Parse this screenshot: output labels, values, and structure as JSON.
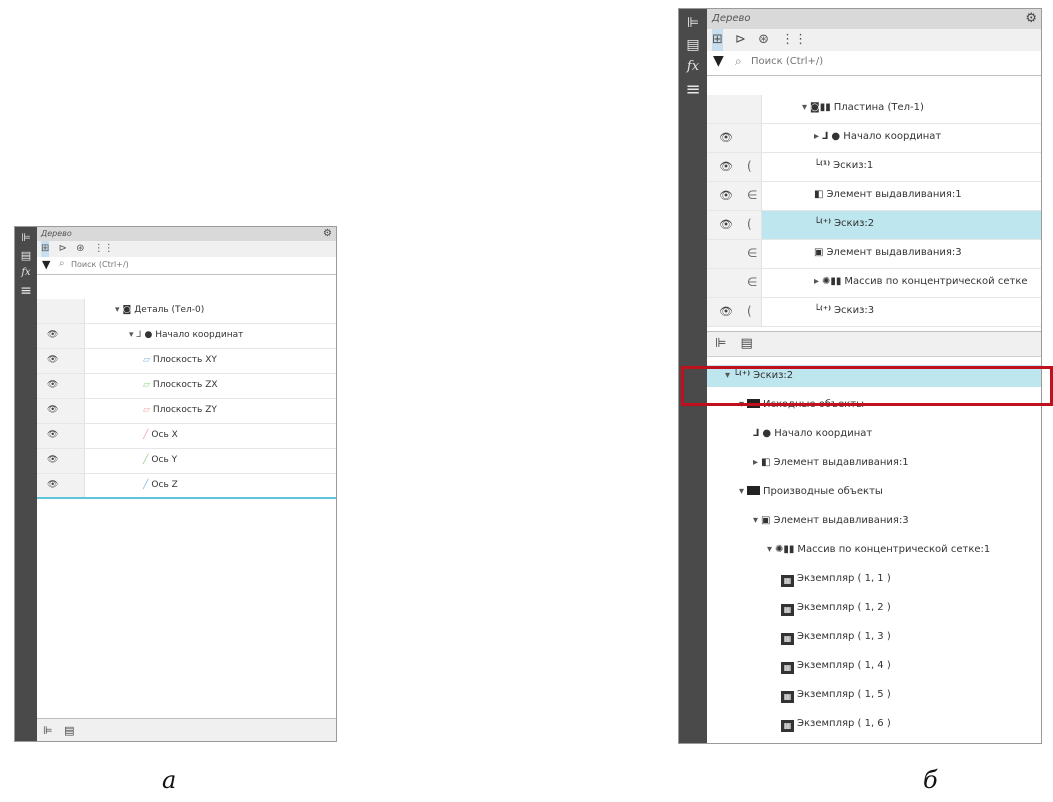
{
  "panel_a": {
    "title": "Дерево",
    "search_placeholder": "Поиск (Ctrl+/)",
    "rows": [
      {
        "label": "Деталь (Тел-0)",
        "indent": 0,
        "eye": false,
        "twisty": "▾",
        "icon": "◙",
        "icon_color": "#333333"
      },
      {
        "label": "● Начало координат",
        "indent": 1,
        "eye": true,
        "twisty": "▾",
        "icon": "⅃",
        "icon_color": "#555555"
      },
      {
        "label": "Плоскость XY",
        "indent": 2,
        "eye": true,
        "twisty": "",
        "icon": "▱",
        "icon_color": "#7ab3e8"
      },
      {
        "label": "Плоскость ZX",
        "indent": 2,
        "eye": true,
        "twisty": "",
        "icon": "▱",
        "icon_color": "#8fd07a"
      },
      {
        "label": "Плоскость ZY",
        "indent": 2,
        "eye": true,
        "twisty": "",
        "icon": "▱",
        "icon_color": "#f0a0a8"
      },
      {
        "label": "Ось X",
        "indent": 2,
        "eye": true,
        "twisty": "",
        "icon": "╱",
        "icon_color": "#f0a0a8"
      },
      {
        "label": "Ось Y",
        "indent": 2,
        "eye": true,
        "twisty": "",
        "icon": "╱",
        "icon_color": "#8fd07a"
      },
      {
        "label": "Ось Z",
        "indent": 2,
        "eye": true,
        "twisty": "",
        "icon": "╱",
        "icon_color": "#7ab3e8"
      }
    ]
  },
  "panel_b": {
    "title": "Дерево",
    "search_placeholder": "Поиск (Ctrl+/)",
    "rows": [
      {
        "label": "Пластина (Тел-1)",
        "indent": 0,
        "eye": false,
        "dep": "",
        "twisty": "▾",
        "icon": "◙▮▮",
        "selected": false
      },
      {
        "label": "● Начало координат",
        "indent": 1,
        "eye": true,
        "dep": "",
        "twisty": "▸",
        "icon": "⅃",
        "selected": false
      },
      {
        "label": "Эскиз:1",
        "indent": 1,
        "eye": true,
        "dep": "(",
        "twisty": "",
        "icon": "└⁽¹⁾",
        "selected": false
      },
      {
        "label": "Элемент выдавливания:1",
        "indent": 1,
        "eye": true,
        "dep": "∈",
        "twisty": "",
        "icon": "◧",
        "selected": false
      },
      {
        "label": "Эскиз:2",
        "indent": 1,
        "eye": true,
        "dep": "(",
        "twisty": "",
        "icon": "└⁽⁺⁾",
        "selected": true
      },
      {
        "label": "Элемент выдавливания:3",
        "indent": 1,
        "eye": false,
        "dep": "∈",
        "twisty": "",
        "icon": "▣",
        "selected": false
      },
      {
        "label": "Массив по концентрической сетке",
        "indent": 1,
        "eye": false,
        "dep": "∈",
        "twisty": "▸",
        "icon": "✺▮▮",
        "selected": false
      },
      {
        "label": "Эскиз:3",
        "indent": 1,
        "eye": true,
        "dep": "(",
        "twisty": "",
        "icon": "└⁽⁺⁾",
        "selected": false
      }
    ],
    "relations": [
      {
        "label": "Эскиз:2",
        "indent": 0,
        "twisty": "▾",
        "icon": "└⁽⁺⁾",
        "selected": true
      },
      {
        "label": "Исходные объекты",
        "indent": 1,
        "twisty": "▾",
        "icon": "folder",
        "selected": false
      },
      {
        "label": "● Начало координат",
        "indent": 2,
        "twisty": "",
        "icon": "⅃",
        "selected": false
      },
      {
        "label": "Элемент выдавливания:1",
        "indent": 2,
        "twisty": "▸",
        "icon": "◧",
        "selected": false
      },
      {
        "label": "Производные объекты",
        "indent": 1,
        "twisty": "▾",
        "icon": "folder",
        "selected": false
      },
      {
        "label": "Элемент выдавливания:3",
        "indent": 2,
        "twisty": "▾",
        "icon": "▣",
        "selected": false
      },
      {
        "label": "Массив по концентрической сетке:1",
        "indent": 3,
        "twisty": "▾",
        "icon": "✺▮▮",
        "selected": false
      },
      {
        "label": "Экземпляр ( 1, 1 )",
        "indent": 4,
        "twisty": "",
        "icon": "inst",
        "selected": false
      },
      {
        "label": "Экземпляр ( 1, 2 )",
        "indent": 4,
        "twisty": "",
        "icon": "inst",
        "selected": false
      },
      {
        "label": "Экземпляр ( 1, 3 )",
        "indent": 4,
        "twisty": "",
        "icon": "inst",
        "selected": false
      },
      {
        "label": "Экземпляр ( 1, 4 )",
        "indent": 4,
        "twisty": "",
        "icon": "inst",
        "selected": false
      },
      {
        "label": "Экземпляр ( 1, 5 )",
        "indent": 4,
        "twisty": "",
        "icon": "inst",
        "selected": false
      },
      {
        "label": "Экземпляр ( 1, 6 )",
        "indent": 4,
        "twisty": "",
        "icon": "inst",
        "selected": false
      }
    ]
  },
  "captions": {
    "a": "а",
    "b": "б"
  },
  "colors": {
    "selection": "#bde6ee",
    "highlight_frame": "#c0101e",
    "accent_line": "#5ec5d8",
    "strip": "#4a4a4a"
  },
  "icons": {
    "tree_tab": "⊫",
    "properties_tab": "▤",
    "formula": "fx",
    "menu": "≡",
    "gear": "⚙",
    "funnel": "▼",
    "search": "⌕",
    "eye": "👁",
    "tb1": "⊞",
    "tb2": "⊳",
    "tb3": "⊛",
    "tb4": "⋮⋮"
  }
}
